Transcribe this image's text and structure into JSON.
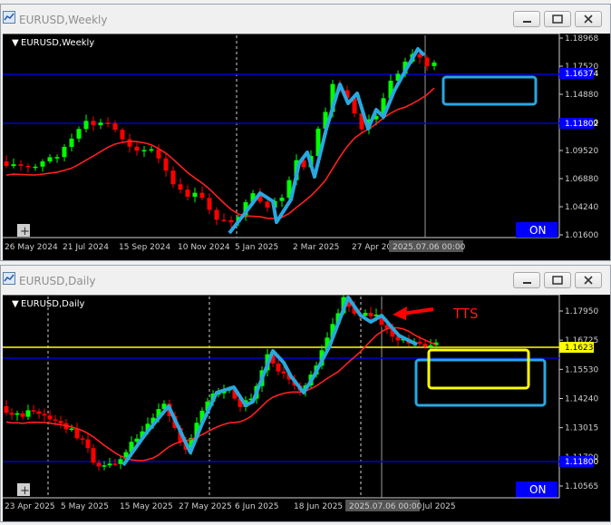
{
  "weekly": {
    "window_title": "EURUSD,Weekly",
    "chart_label": "EURUSD,Weekly",
    "x_labels": [
      "26 May 2024",
      "21 Jul 2024",
      "15 Sep 2024",
      "10 Nov 2024",
      "5 Jan 2025",
      "2 Mar 2025",
      "27 Apr 20"
    ],
    "x_crosshair_label": "2025.07.06 00:00",
    "price_labels": [
      "1.18968",
      "1.17520",
      "1.14880",
      "1.12240",
      "1.09520",
      "1.06880",
      "1.04240",
      "1.01600"
    ],
    "price_tag_1": "1.16374",
    "price_tag_2": "1.11802",
    "on_label": "ON",
    "plus_label": "+"
  },
  "daily": {
    "window_title": "EURUSD,Daily",
    "chart_label": "EURUSD,Daily",
    "x_labels": [
      "23 Apr 2025",
      "5 May 2025",
      "15 May 2025",
      "27 May 2025",
      "6 Jun 2025",
      "18 Jun 2025",
      "Jul 2025"
    ],
    "x_crosshair_label": "2025.07.06 00:00",
    "price_labels": [
      "1.17950",
      "1.16725",
      "1.15530",
      "1.14240",
      "1.13015",
      "1.11790",
      "1.10565"
    ],
    "current_price": "1.16233",
    "price_tag_2": "1.11800",
    "annotation": "TTS",
    "on_label": "ON",
    "plus_label": "+"
  },
  "colors": {
    "bull": "#00ff00",
    "bear": "#ff0000",
    "ma": "#ff2020",
    "hline": "#0000cc",
    "zigzag": "#29a8e0",
    "box": "#29a8e0",
    "yellow": "#ffff00",
    "on_bg": "#0000ff"
  }
}
